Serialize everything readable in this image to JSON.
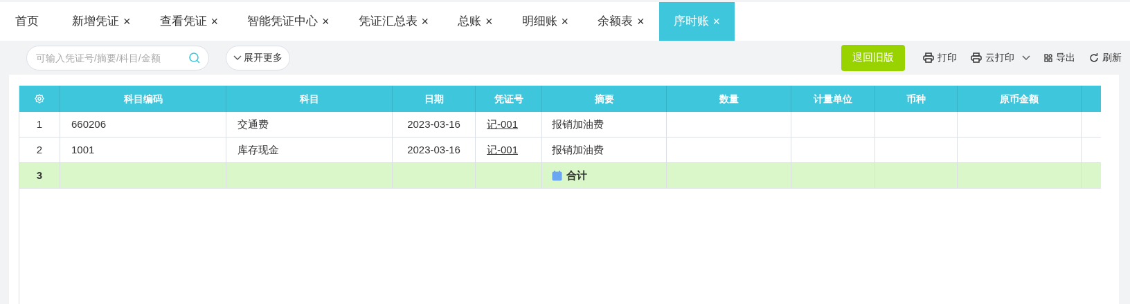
{
  "tabs": [
    {
      "label": "首页",
      "closable": false,
      "selected": false
    },
    {
      "label": "新增凭证",
      "closable": true,
      "selected": false
    },
    {
      "label": "查看凭证",
      "closable": true,
      "selected": false
    },
    {
      "label": "智能凭证中心",
      "closable": true,
      "selected": false
    },
    {
      "label": "凭证汇总表",
      "closable": true,
      "selected": false
    },
    {
      "label": "总账",
      "closable": true,
      "selected": false
    },
    {
      "label": "明细账",
      "closable": true,
      "selected": false
    },
    {
      "label": "余额表",
      "closable": true,
      "selected": false
    },
    {
      "label": "序时账",
      "closable": true,
      "selected": true
    }
  ],
  "close_glyph": "×",
  "search": {
    "placeholder": "可输入凭证号/摘要/科目/金额"
  },
  "expand_button": "展开更多",
  "toolbar": [
    {
      "kind": "primary",
      "label": "退回旧版"
    },
    {
      "kind": "print",
      "label": "打印"
    },
    {
      "kind": "cloud-print",
      "label": "云打印"
    },
    {
      "kind": "export",
      "label": "导出"
    },
    {
      "kind": "refresh",
      "label": "刷新"
    }
  ],
  "table": {
    "columns": [
      "科目编码",
      "科目",
      "日期",
      "凭证号",
      "摘要",
      "数量",
      "计量单位",
      "币种",
      "原币金额"
    ],
    "rows": [
      {
        "kind": "data",
        "index": "1",
        "code": "660206",
        "account": "交通费",
        "date": "2023-03-16",
        "voucher": "记-001",
        "summary": "报销加油费"
      },
      {
        "kind": "data",
        "index": "2",
        "code": "1001",
        "account": "库存现金",
        "date": "2023-03-16",
        "voucher": "记-001",
        "summary": "报销加油费"
      },
      {
        "kind": "total",
        "index": "3",
        "summary": "合计"
      }
    ]
  }
}
